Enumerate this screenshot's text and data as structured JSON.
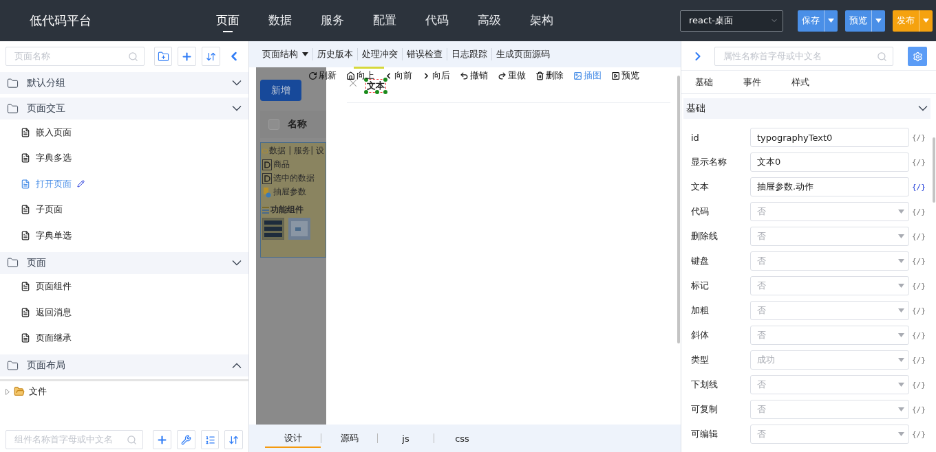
{
  "app": {
    "title": "低代码平台"
  },
  "nav": [
    {
      "label": "页面",
      "selected": true
    },
    {
      "label": "数据",
      "selected": false
    },
    {
      "label": "服务",
      "selected": false
    },
    {
      "label": "配置",
      "selected": false
    },
    {
      "label": "代码",
      "selected": false
    },
    {
      "label": "高级",
      "selected": false
    },
    {
      "label": "架构",
      "selected": false
    }
  ],
  "target_select": {
    "value": "react-桌面"
  },
  "actions": [
    {
      "label": "保存",
      "color": "#4a8fe7"
    },
    {
      "label": "预览",
      "color": "#4a8fe7"
    },
    {
      "label": "发布",
      "color": "#f5a20f"
    }
  ],
  "page_panel": {
    "search": {
      "placeholder": "页面名称"
    },
    "groups": [
      {
        "label": "默认分组",
        "open": true
      },
      {
        "label": "页面交互",
        "open": true,
        "children": [
          {
            "label": "嵌入页面",
            "selected": false
          },
          {
            "label": "字典多选",
            "selected": false
          },
          {
            "label": "打开页面",
            "selected": true
          },
          {
            "label": "子页面",
            "selected": false
          },
          {
            "label": "字典单选",
            "selected": false
          }
        ]
      },
      {
        "label": "页面",
        "open": true,
        "children": [
          {
            "label": "页面组件",
            "selected": false
          },
          {
            "label": "返回消息",
            "selected": false
          },
          {
            "label": "页面继承",
            "selected": false
          }
        ]
      },
      {
        "label": "页面布局",
        "open": false
      }
    ]
  },
  "file_tree": [
    {
      "label": "文件",
      "expanded": false
    }
  ],
  "component_search": {
    "placeholder": "组件名称首字母或中文名"
  },
  "center_toolbar": [
    {
      "label": "页面结构",
      "kind": "dropdown"
    },
    {
      "label": "历史版本",
      "kind": "link"
    },
    {
      "label": "处理冲突",
      "kind": "link"
    },
    {
      "label": "错误检查",
      "kind": "link"
    },
    {
      "label": "日志跟踪",
      "kind": "link"
    },
    {
      "label": "生成页面源码",
      "kind": "link"
    }
  ],
  "background_page": {
    "add_button": "新增",
    "select_all_checked": false,
    "column_header": "名称",
    "panel_title": "数据 | 服务| 设",
    "panel_items": [
      {
        "label": "商品",
        "kind": "data"
      },
      {
        "label": "选中的数据",
        "kind": "data"
      },
      {
        "label": "抽屉参数",
        "kind": "param"
      }
    ],
    "section": "功能组件"
  },
  "drawer": {
    "toolbar": [
      {
        "label": "刷新",
        "kind": "refresh",
        "active": false
      },
      {
        "label": "向上",
        "kind": "up",
        "active": false
      },
      {
        "label": "向前",
        "kind": "back",
        "active": false
      },
      {
        "label": "向后",
        "kind": "forward",
        "active": false
      },
      {
        "label": "撤销",
        "kind": "undo",
        "active": false
      },
      {
        "label": "重做",
        "kind": "redo",
        "active": false
      },
      {
        "label": "删除",
        "kind": "delete",
        "active": false
      },
      {
        "label": "插图",
        "kind": "image",
        "active": true
      },
      {
        "label": "预览",
        "kind": "preview",
        "active": false
      }
    ],
    "selected_component": "文本"
  },
  "editor_tabs": [
    {
      "label": "设计",
      "selected": true
    },
    {
      "label": "源码",
      "selected": false
    },
    {
      "label": "js",
      "selected": false
    },
    {
      "label": "css",
      "selected": false
    }
  ],
  "properties": {
    "search": {
      "placeholder": "属性名称首字母或中文名"
    },
    "tabs": [
      "基础",
      "事件",
      "样式"
    ],
    "section": {
      "title": "基础",
      "open": true
    },
    "fields": [
      {
        "label": "id",
        "kind": "input",
        "value": "typographyText0",
        "binding": "{/}",
        "bound": false
      },
      {
        "label": "显示名称",
        "kind": "input",
        "value": "文本0",
        "binding": "{/}",
        "bound": false
      },
      {
        "label": "文本",
        "kind": "input",
        "value": "抽屉参数.动作",
        "binding": "{/}",
        "bound": true
      },
      {
        "label": "代码",
        "kind": "select",
        "value": "否",
        "binding": "{/}",
        "bound": false
      },
      {
        "label": "删除线",
        "kind": "select",
        "value": "否",
        "binding": "{/}",
        "bound": false
      },
      {
        "label": "键盘",
        "kind": "select",
        "value": "否",
        "binding": "{/}",
        "bound": false
      },
      {
        "label": "标记",
        "kind": "select",
        "value": "否",
        "binding": "{/}",
        "bound": false
      },
      {
        "label": "加粗",
        "kind": "select",
        "value": "否",
        "binding": "{/}",
        "bound": false
      },
      {
        "label": "斜体",
        "kind": "select",
        "value": "否",
        "binding": "{/}",
        "bound": false
      },
      {
        "label": "类型",
        "kind": "select",
        "value": "成功",
        "binding": "{/}",
        "bound": false
      },
      {
        "label": "下划线",
        "kind": "select",
        "value": "否",
        "binding": "{/}",
        "bound": false
      },
      {
        "label": "可复制",
        "kind": "select",
        "value": "否",
        "binding": "{/}",
        "bound": false
      },
      {
        "label": "可编辑",
        "kind": "select",
        "value": "否",
        "binding": "{/}",
        "bound": false
      }
    ]
  }
}
